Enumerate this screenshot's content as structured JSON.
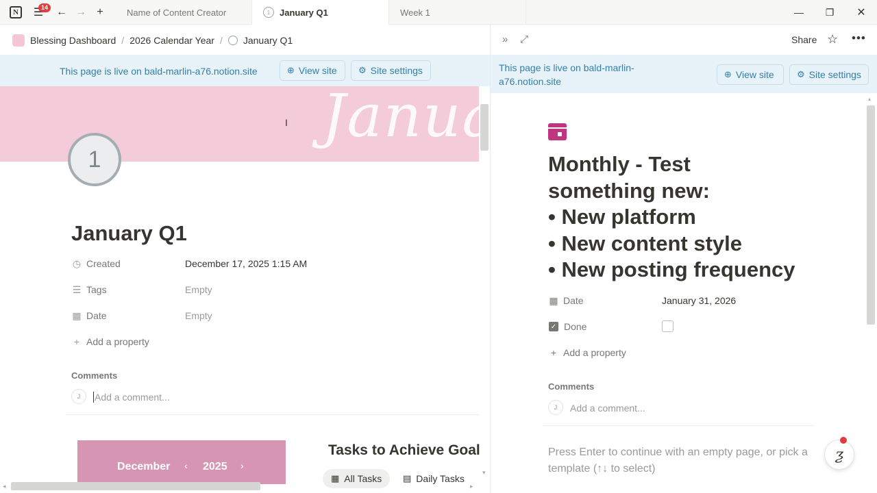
{
  "titlebar": {
    "badge_count": "14",
    "tabs": [
      {
        "label": "Name of Content Creator"
      },
      {
        "label": "January Q1"
      },
      {
        "label": "Week 1"
      }
    ]
  },
  "breadcrumb": {
    "items": [
      "Blessing Dashboard",
      "2026 Calendar Year",
      "January Q1"
    ],
    "separator": "/"
  },
  "left_page": {
    "live_text": "This page is live on bald-marlin-a76.notion.site",
    "view_site_label": "View site",
    "site_settings_label": "Site settings",
    "icon_glyph": "1",
    "title": "January Q1",
    "properties": [
      {
        "name": "Created",
        "value": "December 17, 2025 1:15 AM"
      },
      {
        "name": "Tags",
        "value": "Empty"
      },
      {
        "name": "Date",
        "value": "Empty"
      }
    ],
    "add_property_label": "Add a property",
    "comments_heading": "Comments",
    "avatar_initial": "J",
    "comment_placeholder": "Add a comment...",
    "calendar": {
      "month": "December",
      "year": "2025",
      "prev": "‹",
      "next": "›"
    },
    "tasks_title": "Tasks to Achieve Goal",
    "view_tabs": [
      {
        "label": "All Tasks",
        "icon": "table-icon"
      },
      {
        "label": "Daily Tasks",
        "icon": "calendar-icon"
      }
    ]
  },
  "right_page": {
    "share_label": "Share",
    "live_text": "This page is live on bald-marlin-a76.notion.site",
    "view_site_label": "View site",
    "site_settings_label": "Site settings",
    "title_lines": [
      "Monthly - Test",
      "something new:",
      "• New platform",
      "• New content style",
      "• New posting frequency"
    ],
    "properties": [
      {
        "name": "Date",
        "value": "January 31, 2026"
      },
      {
        "name": "Done",
        "checked": false
      }
    ],
    "add_property_label": "Add a property",
    "comments_heading": "Comments",
    "avatar_initial": "J",
    "comment_placeholder": "Add a comment...",
    "hint": "Press Enter to continue with an empty page, or pick a template (↑↓ to select)"
  },
  "colors": {
    "accent_blue": "#337ea9",
    "live_bar_bg": "#e7f3f8",
    "cover_pink": "#f3cbd9",
    "calendar_pink": "#d795b4",
    "page_icon_magenta": "#c0357f",
    "badge_red": "#e03e3e"
  }
}
